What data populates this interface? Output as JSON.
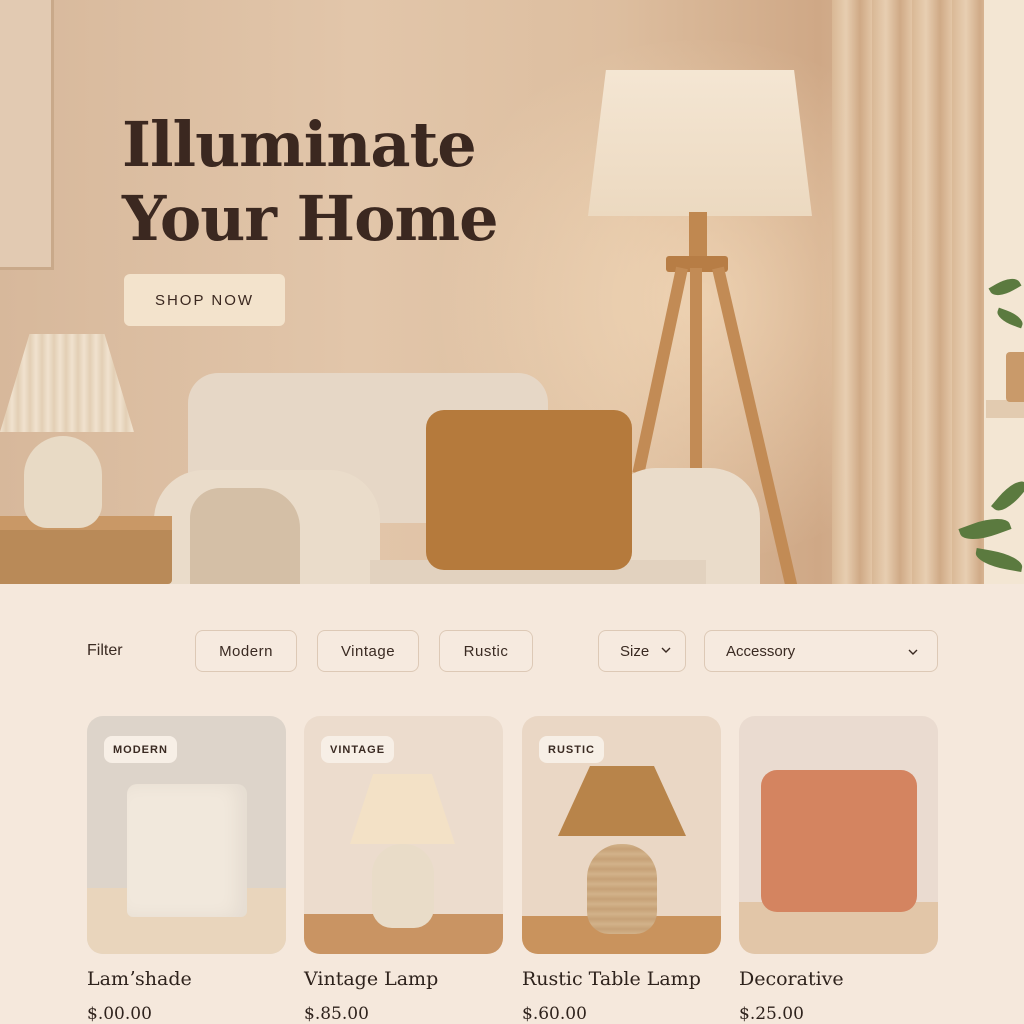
{
  "hero": {
    "title_line1": "Illuminate",
    "title_line2": "Your Home",
    "cta_label": "SHOP NOW"
  },
  "filters": {
    "label": "Filter",
    "chips": [
      "Modern",
      "Vintage",
      "Rustic"
    ],
    "size_select": {
      "selected": "Size",
      "icon": "chevron-down-icon"
    },
    "category_select": {
      "selected": "Accessory",
      "icon": "chevron-down-icon"
    }
  },
  "products": [
    {
      "badge": "MODERN",
      "title": "Lamʼshade",
      "price": "$.00.00"
    },
    {
      "badge": "VINTAGE",
      "title": "Vintage Lamp",
      "price": "$.85.00"
    },
    {
      "badge": "RUSTIC",
      "title": "Rustic Table Lamp",
      "price": "$.60.00"
    },
    {
      "badge": "",
      "title": "Decorative",
      "price": "$.25.00"
    }
  ],
  "colors": {
    "background": "#f5e8dc",
    "cta_background": "#f3e3cc",
    "text_dark": "#3b2820",
    "chip_border": "#ddc9b6"
  }
}
